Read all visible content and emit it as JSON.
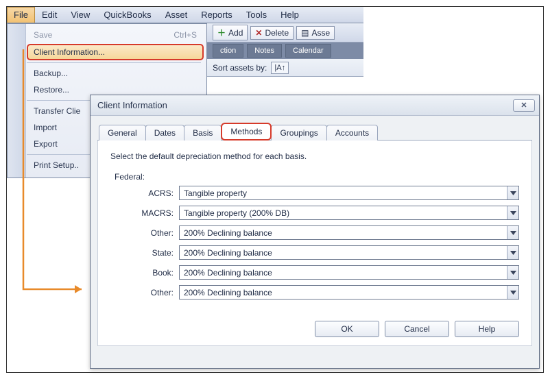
{
  "menubar": [
    "File",
    "Edit",
    "View",
    "QuickBooks",
    "Asset",
    "Reports",
    "Tools",
    "Help"
  ],
  "toolbar": {
    "add": "Add",
    "delete": "Delete",
    "asset": "Asse"
  },
  "subtabs": {
    "a": "ction",
    "b": "Notes",
    "c": "Calendar"
  },
  "sortlabel": "Sort assets by:",
  "file_menu": {
    "save": "Save",
    "save_short": "Ctrl+S",
    "client_info": "Client Information...",
    "backup": "Backup...",
    "restore": "Restore...",
    "transfer": "Transfer Clie",
    "import": "Import",
    "export": "Export",
    "print_setup": "Print Setup.."
  },
  "dialog": {
    "title": "Client Information",
    "tabs": {
      "general": "General",
      "dates": "Dates",
      "basis": "Basis",
      "methods": "Methods",
      "groupings": "Groupings",
      "accounts": "Accounts"
    },
    "desc": "Select the default depreciation method for each basis.",
    "federal_label": "Federal:",
    "labels": {
      "acrs": "ACRS:",
      "macrs": "MACRS:",
      "other1": "Other:",
      "state": "State:",
      "book": "Book:",
      "other2": "Other:"
    },
    "values": {
      "acrs": "Tangible property",
      "macrs": "Tangible property (200% DB)",
      "other1": "200% Declining balance",
      "state": "200% Declining balance",
      "book": "200% Declining balance",
      "other2": "200% Declining balance"
    },
    "buttons": {
      "ok": "OK",
      "cancel": "Cancel",
      "help": "Help"
    }
  }
}
